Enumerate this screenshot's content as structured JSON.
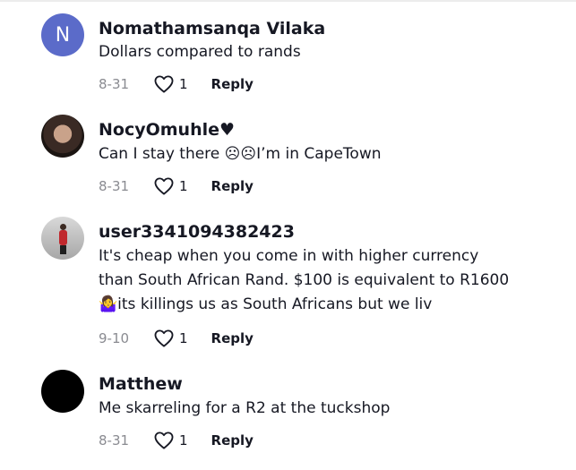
{
  "comments": [
    {
      "avatar_initial": "N",
      "username": "Nomathamsanqa Vilaka",
      "text": "Dollars compared to rands",
      "date": "8-31",
      "likes": "1",
      "reply_label": "Reply"
    },
    {
      "username": "NocyOmuhle♥",
      "text": "Can I stay there ☹☹I’m in CapeTown",
      "date": "8-31",
      "likes": "1",
      "reply_label": "Reply"
    },
    {
      "username": "user3341094382423",
      "text": "It's cheap when you come in with higher currency than South African Rand. $100 is equivalent to R1600🤷‍♀️its killings us as South Africans but we liv",
      "date": "9-10",
      "likes": "1",
      "reply_label": "Reply"
    },
    {
      "username": "Matthew",
      "text": "Me skarreling for a R2 at the tuckshop",
      "date": "8-31",
      "likes": "1",
      "reply_label": "Reply"
    }
  ],
  "icons": {
    "like": "heart-outline-icon"
  },
  "colors": {
    "text": "#161823",
    "muted": "#8a8b91",
    "avatar_letter_bg": "#5b6bc9"
  }
}
